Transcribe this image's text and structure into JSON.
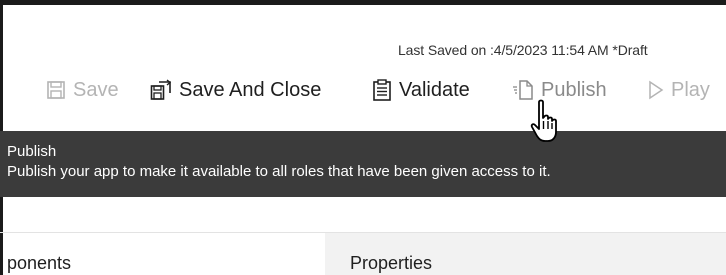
{
  "header": {
    "last_saved": "Last Saved on :4/5/2023 11:54 AM *Draft"
  },
  "toolbar": {
    "save_label": "Save",
    "save_and_close_label": "Save And Close",
    "validate_label": "Validate",
    "publish_label": "Publish",
    "play_label": "Play"
  },
  "tooltip": {
    "title": "Publish",
    "description": "Publish your app to make it available to all roles that have been given access to it."
  },
  "tabs": {
    "components_label": "ponents",
    "properties_label": "Properties"
  },
  "colors": {
    "tooltip_background": "#3b3b3b",
    "disabled_text": "#b4b4b4",
    "properties_tab_background": "#f2f2f2"
  }
}
